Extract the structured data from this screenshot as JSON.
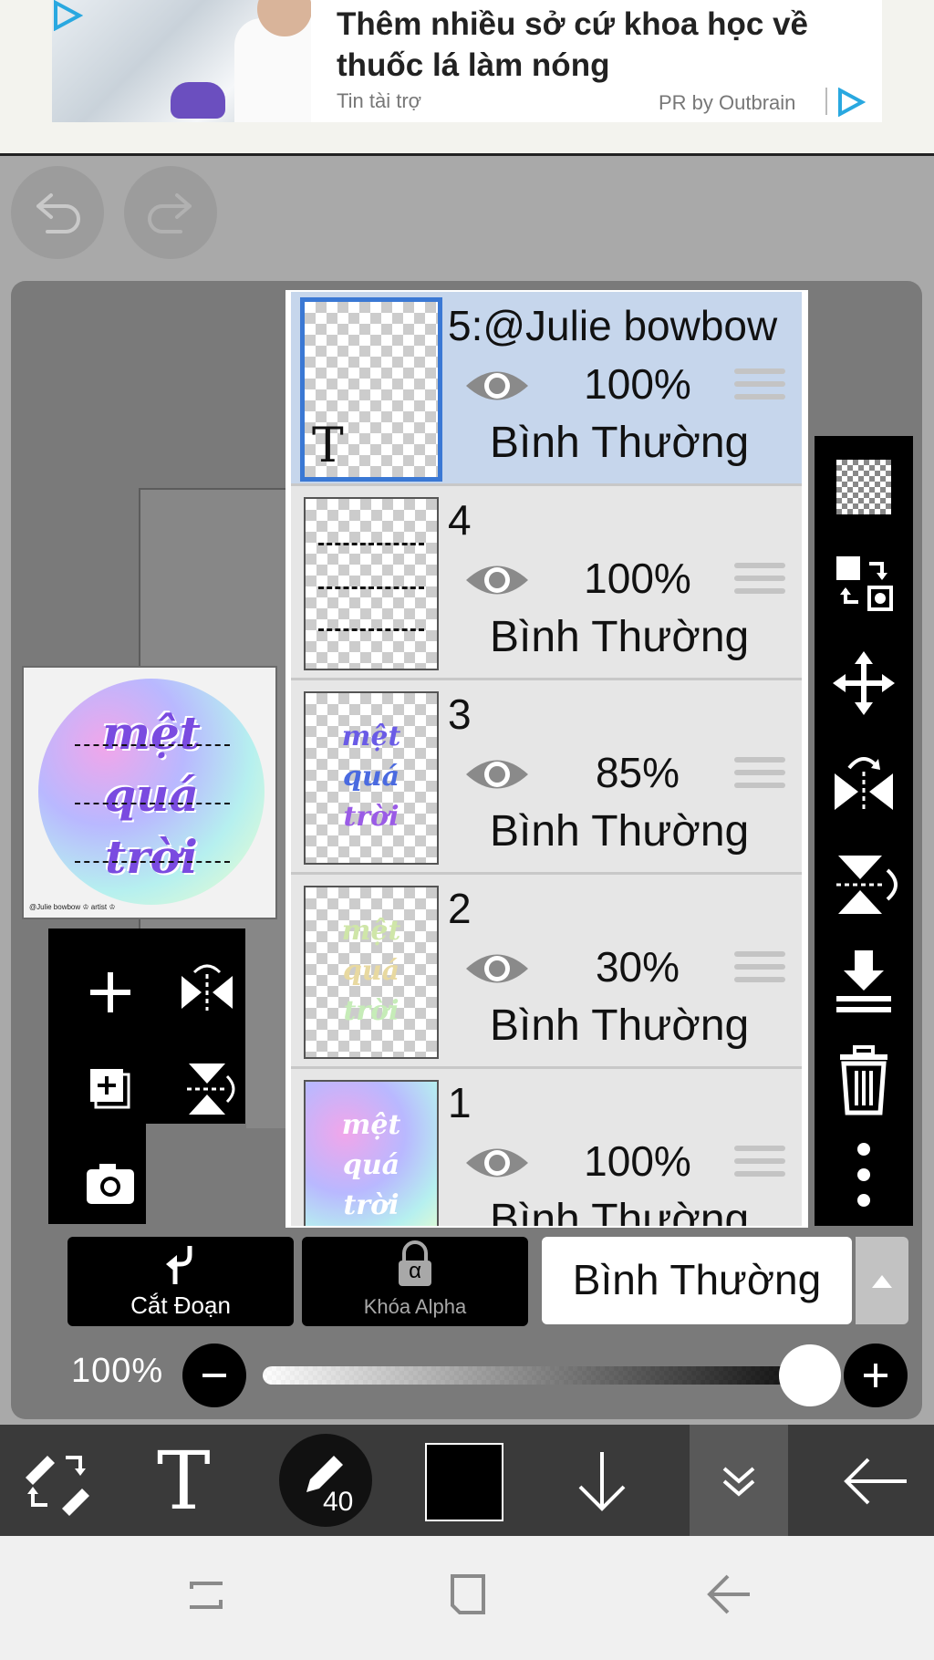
{
  "ad": {
    "title": "Thêm nhiều sở cứ khoa học về thuốc lá làm nóng",
    "sponsor": "Tin tài trợ",
    "provider": "PR by Outbrain"
  },
  "history": {
    "undo_icon": "undo-icon",
    "redo_icon": "redo-icon"
  },
  "preview": {
    "lines": [
      "mệt",
      "quá",
      "trời"
    ],
    "credit": "@Julie bowbow ♔ artist ♔"
  },
  "layers": [
    {
      "name": "5:@Julie bowbow",
      "opacity": "100%",
      "blend": "Bình Thường",
      "selected": true
    },
    {
      "name": "4",
      "opacity": "100%",
      "blend": "Bình Thường",
      "selected": false
    },
    {
      "name": "3",
      "opacity": "85%",
      "blend": "Bình Thường",
      "selected": false
    },
    {
      "name": "2",
      "opacity": "30%",
      "blend": "Bình Thường",
      "selected": false
    },
    {
      "name": "1",
      "opacity": "100%",
      "blend": "Bình Thường",
      "selected": false
    }
  ],
  "thumb_text": "T",
  "controls": {
    "clip_label": "Cắt Đoạn",
    "alpha_lock_label": "Khóa Alpha",
    "alpha_symbol": "α",
    "blend_mode": "Bình Thường",
    "opacity_label": "100%",
    "opacity_value": 1.0
  },
  "toolbar": {
    "brush_size": "40",
    "color": "#000000"
  },
  "colors": {
    "accent": "#3a78d4",
    "selected_row": "#c6d6ec"
  }
}
